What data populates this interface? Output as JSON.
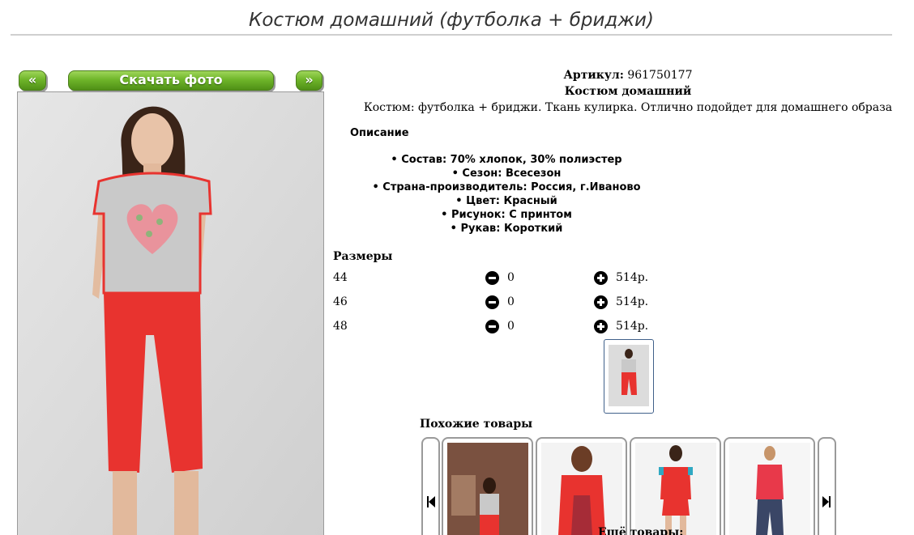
{
  "page_title": "Костюм домашний (футболка + бриджи)",
  "nav": {
    "prev_label": "«",
    "download_label": "Скачать фото",
    "next_label": "»"
  },
  "product": {
    "sku_label": "Артикул:",
    "sku_value": "961750177",
    "name": "Костюм домашний",
    "description": "Костюм: футболка + бриджи. Ткань кулирка. Отлично подойдет для домашнего образа"
  },
  "description_heading": "Описание",
  "properties": [
    "Состав: 70% хлопок, 30% полиэстер",
    "Сезон: Всесезон",
    "Страна-производитель: Россия, г.Иваново",
    "Цвет: Красный",
    "Рисунок: С принтом",
    "Рукав: Короткий"
  ],
  "sizes_heading": "Размеры",
  "sizes": [
    {
      "size": "44",
      "qty": "0",
      "price": "514р."
    },
    {
      "size": "46",
      "qty": "0",
      "price": "514р."
    },
    {
      "size": "48",
      "qty": "0",
      "price": "514р."
    }
  ],
  "similar_heading": "Похожие товары",
  "more_heading": "Ещё товары:",
  "colors": {
    "button_green": "#6fb52a",
    "pants_red": "#e8332f",
    "shirt_grey": "#c9c9c9"
  }
}
